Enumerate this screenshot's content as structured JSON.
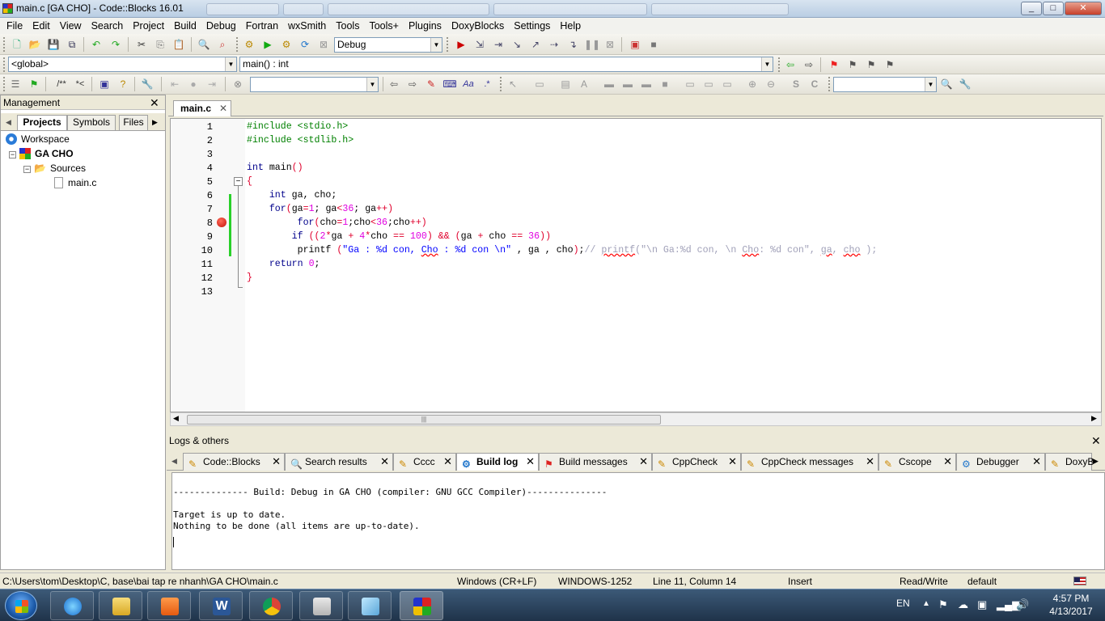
{
  "window": {
    "title": "main.c [GA CHO] - Code::Blocks 16.01",
    "minimize": "_",
    "maximize": "□",
    "close": "✕"
  },
  "menu": [
    "File",
    "Edit",
    "View",
    "Search",
    "Project",
    "Build",
    "Debug",
    "Fortran",
    "wxSmith",
    "Tools",
    "Tools+",
    "Plugins",
    "DoxyBlocks",
    "Settings",
    "Help"
  ],
  "toolbar": {
    "build_target": "Debug",
    "scope": "<global>",
    "function": "main() : int",
    "search_combo": "",
    "code_completion_combo": ""
  },
  "management": {
    "title": "Management",
    "tabs": [
      "Projects",
      "Symbols",
      "Files"
    ],
    "tree": {
      "workspace": "Workspace",
      "project": "GA CHO",
      "folder": "Sources",
      "file": "main.c"
    }
  },
  "editor": {
    "tab_label": "main.c",
    "lines": [
      {
        "n": "1",
        "text": "#include <stdio.h>"
      },
      {
        "n": "2",
        "text": "#include <stdlib.h>"
      },
      {
        "n": "3",
        "text": ""
      },
      {
        "n": "4",
        "text": "int main()"
      },
      {
        "n": "5",
        "text": "{"
      },
      {
        "n": "6",
        "text": "    int ga, cho;"
      },
      {
        "n": "7",
        "text": "    for(ga=1; ga<36; ga++)"
      },
      {
        "n": "8",
        "text": "         for(cho=1;cho<36;cho++)"
      },
      {
        "n": "9",
        "text": "        if ((2*ga + 4*cho == 100) && (ga + cho == 36))"
      },
      {
        "n": "10",
        "text": "         printf (\"Ga : %d con, Cho : %d con \\n\" , ga , cho);// printf(\"\\n Ga:%d con, \\n Cho: %d con\", ga, cho );"
      },
      {
        "n": "11",
        "text": "    return 0;"
      },
      {
        "n": "12",
        "text": "}"
      },
      {
        "n": "13",
        "text": ""
      }
    ],
    "breakpoint_line": 8
  },
  "logs": {
    "title": "Logs & others",
    "tabs": [
      "Code::Blocks",
      "Search results",
      "Cccc",
      "Build log",
      "Build messages",
      "CppCheck",
      "CppCheck messages",
      "Cscope",
      "Debugger",
      "DoxyB"
    ],
    "active_tab": "Build log",
    "lines": [
      "-------------- Build: Debug in GA CHO (compiler: GNU GCC Compiler)---------------",
      "",
      "Target is up to date.",
      "Nothing to be done (all items are up-to-date)."
    ]
  },
  "status": {
    "path": "C:\\Users\\tom\\Desktop\\C, base\\bai tap re nhanh\\GA CHO\\main.c",
    "eol": "Windows (CR+LF)",
    "encoding": "WINDOWS-1252",
    "position": "Line 11, Column 14",
    "mode": "Insert",
    "access": "Read/Write",
    "profile": "default"
  },
  "taskbar": {
    "lang": "EN",
    "time": "4:57 PM",
    "date": "4/13/2017"
  }
}
